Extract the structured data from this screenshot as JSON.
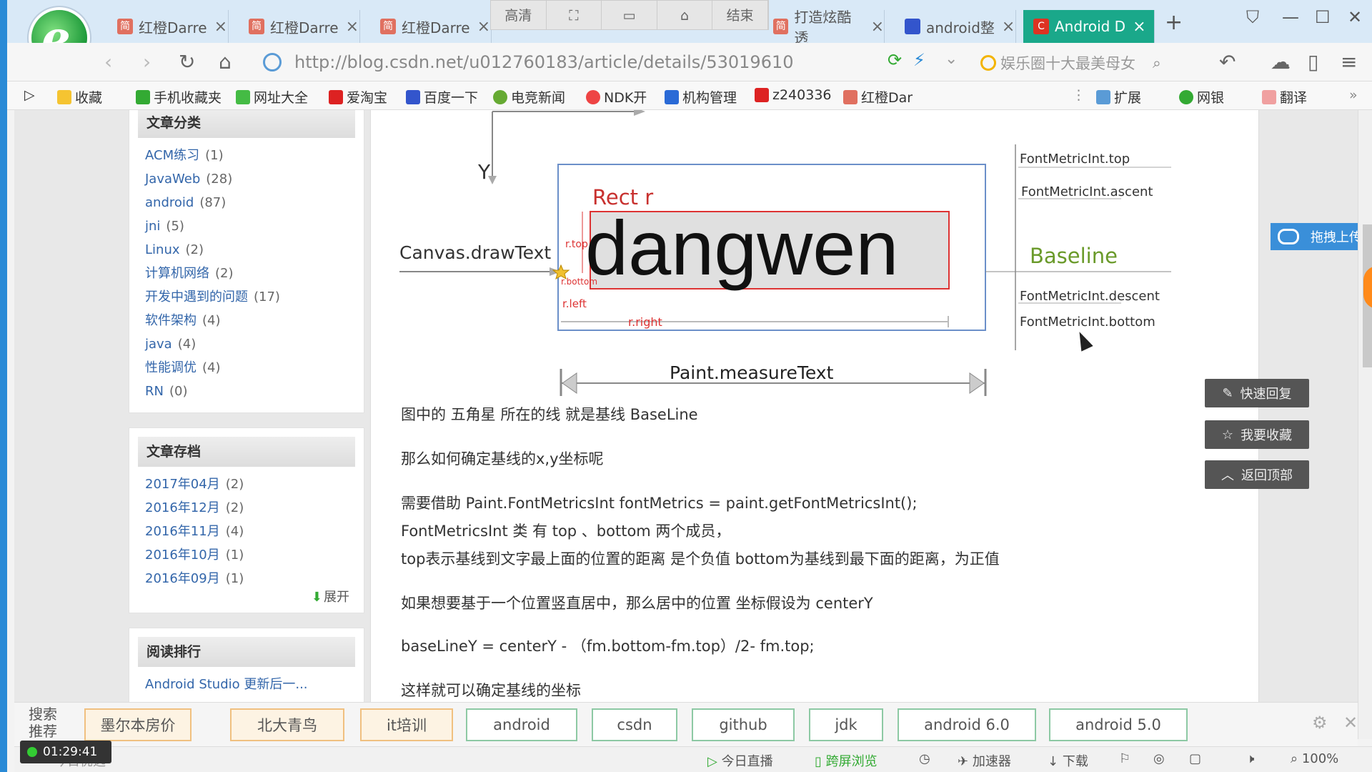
{
  "tabs": [
    {
      "label": "红橙Darre",
      "icon": "简"
    },
    {
      "label": "红橙Darre",
      "icon": "简"
    },
    {
      "label": "红橙Darre",
      "icon": "简"
    },
    {
      "label": "打造炫酷透",
      "icon": "简"
    },
    {
      "label": "android整",
      "icon": "paw"
    },
    {
      "label": "Android D",
      "icon": "C",
      "active": true
    }
  ],
  "video_controls": [
    "高清",
    "⛶",
    "▭",
    "⌂",
    "结束"
  ],
  "address": {
    "url": "http://blog.csdn.net/u012760183/article/details/53019610",
    "search_placeholder": "娱乐圈十大最美母女"
  },
  "bookmarks": [
    "收藏",
    "手机收藏夹",
    "网址大全",
    "爱淘宝",
    "百度一下",
    "电竞新闻",
    "NDK开",
    "机构管理",
    "z240336",
    "红橙Dar",
    "扩展",
    "网银",
    "翻译"
  ],
  "sidebar": {
    "categories_title": "文章分类",
    "categories": [
      {
        "name": "ACM练习",
        "count": "(1)"
      },
      {
        "name": "JavaWeb",
        "count": "(28)"
      },
      {
        "name": "android",
        "count": "(87)"
      },
      {
        "name": "jni",
        "count": "(5)"
      },
      {
        "name": "Linux",
        "count": "(2)"
      },
      {
        "name": "计算机网络",
        "count": "(2)"
      },
      {
        "name": "开发中遇到的问题",
        "count": "(17)"
      },
      {
        "name": "软件架构",
        "count": "(4)"
      },
      {
        "name": "java",
        "count": "(4)"
      },
      {
        "name": "性能调优",
        "count": "(4)"
      },
      {
        "name": "RN",
        "count": "(0)"
      }
    ],
    "archive_title": "文章存档",
    "archive": [
      {
        "name": "2017年04月",
        "count": "(2)"
      },
      {
        "name": "2016年12月",
        "count": "(2)"
      },
      {
        "name": "2016年11月",
        "count": "(4)"
      },
      {
        "name": "2016年10月",
        "count": "(1)"
      },
      {
        "name": "2016年09月",
        "count": "(1)"
      }
    ],
    "expand": "展开",
    "ranking_title": "阅读排行",
    "ranking_first": "Android Studio 更新后一..."
  },
  "diagram": {
    "y_label": "Y",
    "canvas_label": "Canvas.drawText",
    "rect_label": "Rect r",
    "word": "dangwen",
    "r_top": "r.top",
    "r_bottom": "r.bottom",
    "r_left": "r.left",
    "r_right": "r.right",
    "metrics": [
      "FontMetricInt.top",
      "FontMetricInt.ascent",
      "Baseline",
      "FontMetricInt.descent",
      "FontMetricInt.bottom"
    ],
    "measure_label": "Paint.measureText"
  },
  "article": {
    "paragraphs": [
      "图中的 五角星 所在的线 就是基线 BaseLine",
      "那么如何确定基线的x,y坐标呢",
      "需要借助 Paint.FontMetricsInt fontMetrics = paint.getFontMetricsInt();",
      "FontMetricsInt 类 有 top 、bottom 两个成员，",
      "top表示基线到文字最上面的位置的距离 是个负值 bottom为基线到最下面的距离，为正值",
      "如果想要基于一个位置竖直居中，那么居中的位置 坐标假设为 centerY",
      "baseLineY = centerY - （fm.bottom-fm.top）/2- fm.top;",
      "这样就可以确定基线的坐标"
    ]
  },
  "side_buttons": [
    "快速回复",
    "我要收藏",
    "返回顶部"
  ],
  "upload_label": "拖拽上传",
  "recommend": {
    "title": "搜索推荐",
    "chips": [
      "墨尔本房价",
      "北大青鸟",
      "it培训",
      "android",
      "csdn",
      "github",
      "jdk",
      "android 6.0",
      "android 5.0"
    ]
  },
  "status": {
    "today": "今日优选",
    "live": "今日直播",
    "cross": "跨屏浏览",
    "accel": "加速器",
    "download": "下载",
    "zoom": "100%"
  },
  "timer": "01:29:41"
}
